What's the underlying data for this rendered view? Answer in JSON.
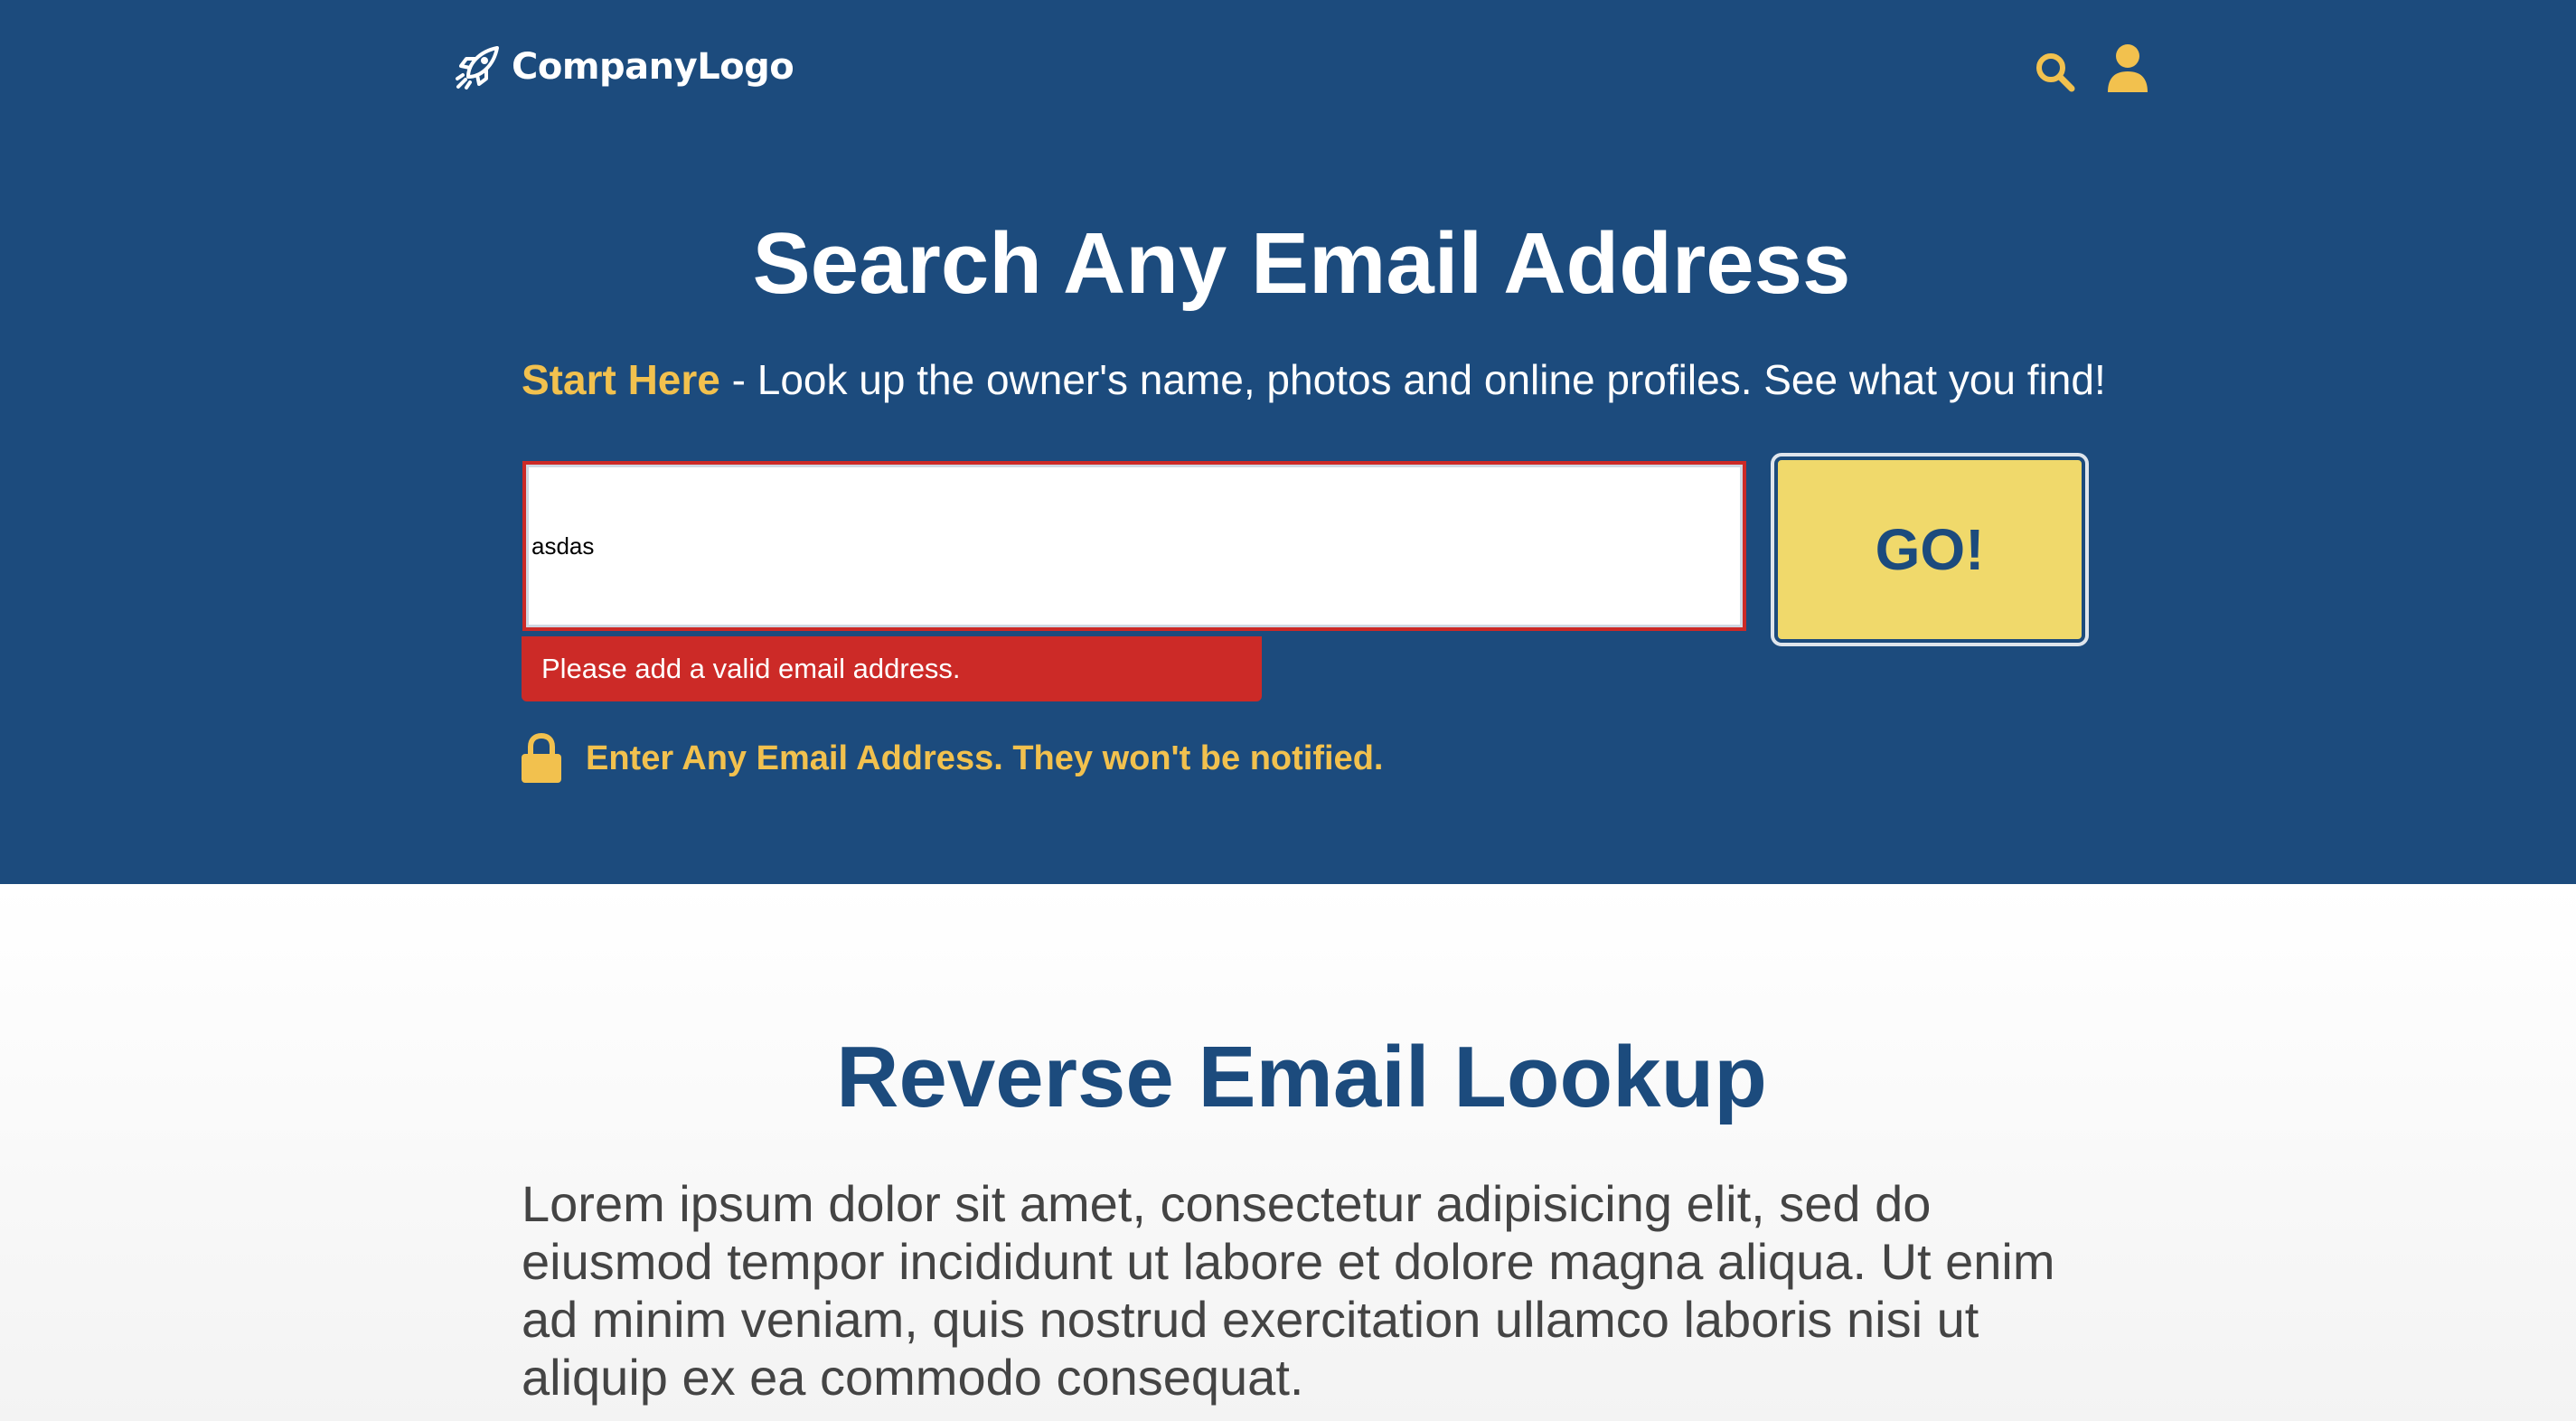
{
  "colors": {
    "brand_blue": "#1c4b7d",
    "accent_yellow": "#f2c14e",
    "button_yellow": "#f0d96b",
    "error_red": "#cc2a27"
  },
  "header": {
    "logo_text": "CompanyLogo",
    "logo_icon": "rocket-icon",
    "search_icon": "search-icon",
    "user_icon": "user-icon"
  },
  "hero": {
    "title": "Search Any Email Address",
    "subtitle_highlight": "Start Here",
    "subtitle_rest": " - Look up the owner's name, photos and online profiles. See what you find!",
    "input_value": "asdas",
    "error_message": "Please add a valid email address.",
    "go_label": "GO!",
    "notice": "Enter Any Email Address. They won't be notified.",
    "notice_icon": "lock-icon"
  },
  "section": {
    "title": "Reverse Email Lookup",
    "body": "Lorem ipsum dolor sit amet, consectetur adipisicing elit, sed do eiusmod tempor incididunt ut labore et dolore magna aliqua. Ut enim ad minim veniam, quis nostrud exercitation ullamco laboris nisi ut aliquip ex ea commodo consequat."
  }
}
